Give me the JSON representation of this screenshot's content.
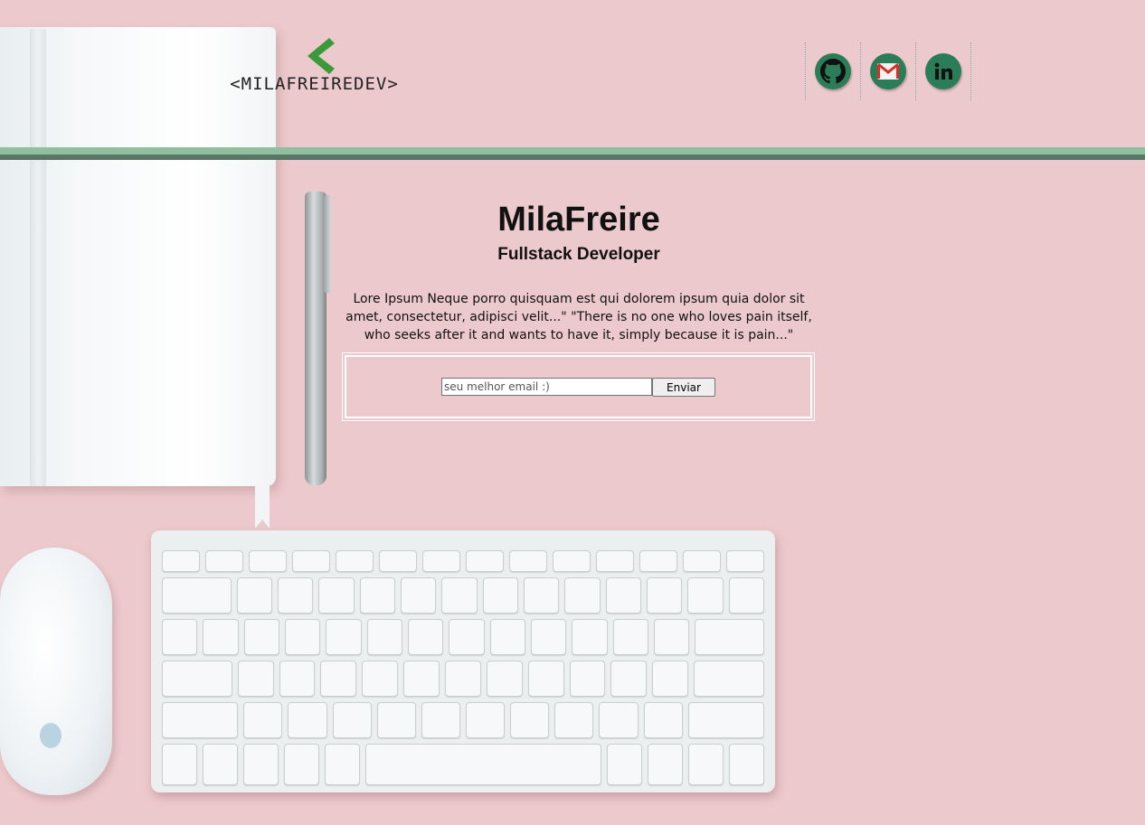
{
  "header": {
    "logo_text": "<MILAFREIREDEV>",
    "social": [
      {
        "icon": "github-icon",
        "label": "GitHub"
      },
      {
        "icon": "gmail-icon",
        "label": "Gmail"
      },
      {
        "icon": "linkedin-icon",
        "label": "LinkedIn"
      }
    ]
  },
  "main": {
    "name": "MilaFreire",
    "role": "Fullstack Developer",
    "description": "Lore Ipsum Neque porro quisquam est qui dolorem ipsum quia dolor sit amet, consectetur, adipisci velit...\" \"There is no one who loves pain itself, who seeks after it and wants to have it, simply because it is pain...\""
  },
  "newsletter": {
    "email_placeholder": "seu melhor email :)",
    "email_value": "",
    "submit_label": "Enviar"
  },
  "colors": {
    "background": "#ecc9cc",
    "accent_green": "#2a7d57",
    "stripe_light": "#8fbf9f",
    "stripe_dark": "#5b7566"
  }
}
